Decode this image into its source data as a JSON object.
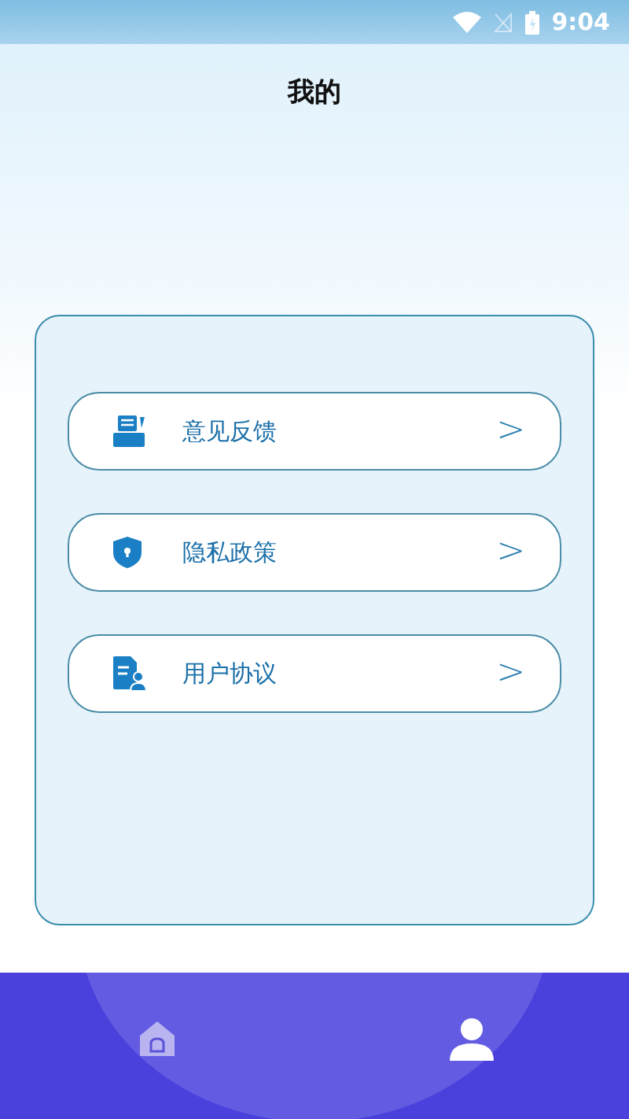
{
  "status_bar": {
    "time": "9:04"
  },
  "header": {
    "title": "我的"
  },
  "menu": [
    {
      "kind": "feedback",
      "label": "意见反馈",
      "chevron": ">"
    },
    {
      "kind": "privacy",
      "label": "隐私政策",
      "chevron": ">"
    },
    {
      "kind": "agreement",
      "label": "用户协议",
      "chevron": ">"
    }
  ],
  "bottom_nav": [
    {
      "kind": "home",
      "selected": false
    },
    {
      "kind": "profile",
      "selected": true
    }
  ]
}
